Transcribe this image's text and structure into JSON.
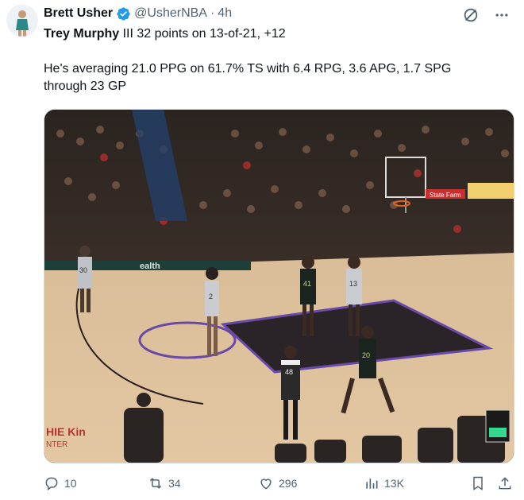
{
  "author": {
    "name": "Brett Usher",
    "handle": "@UsherNBA",
    "separator": "·",
    "time": "4h",
    "verified": true
  },
  "tweet": {
    "line1_bold": "Trey Murphy",
    "line1_rest": " III 32 points on 13-of-21, +12",
    "line2": "He's averaging 21.0 PPG on 61.7% TS with 6.4 RPG, 3.6 APG, 1.7 SPG",
    "line3": "through 23 GP"
  },
  "media": {
    "video_frame": {
      "court_sign": "ealth",
      "ad_left": "HIE Kin",
      "ad_left2": "NTER",
      "jerseys": [
        "30",
        "2",
        "41",
        "13",
        "20",
        "48"
      ],
      "state_farm": "State Farm"
    }
  },
  "actions": {
    "replies": "10",
    "reposts": "34",
    "likes": "296",
    "views": "13K"
  },
  "colors": {
    "accent": "#1d9bf0",
    "muted": "#536471",
    "text": "#0f1419"
  },
  "icons": {
    "verified": "verified-badge-icon",
    "grok": "grok-icon",
    "more": "more-icon",
    "reply": "reply-icon",
    "repost": "repost-icon",
    "like": "heart-icon",
    "views": "views-icon",
    "bookmark": "bookmark-icon",
    "share": "share-icon"
  }
}
